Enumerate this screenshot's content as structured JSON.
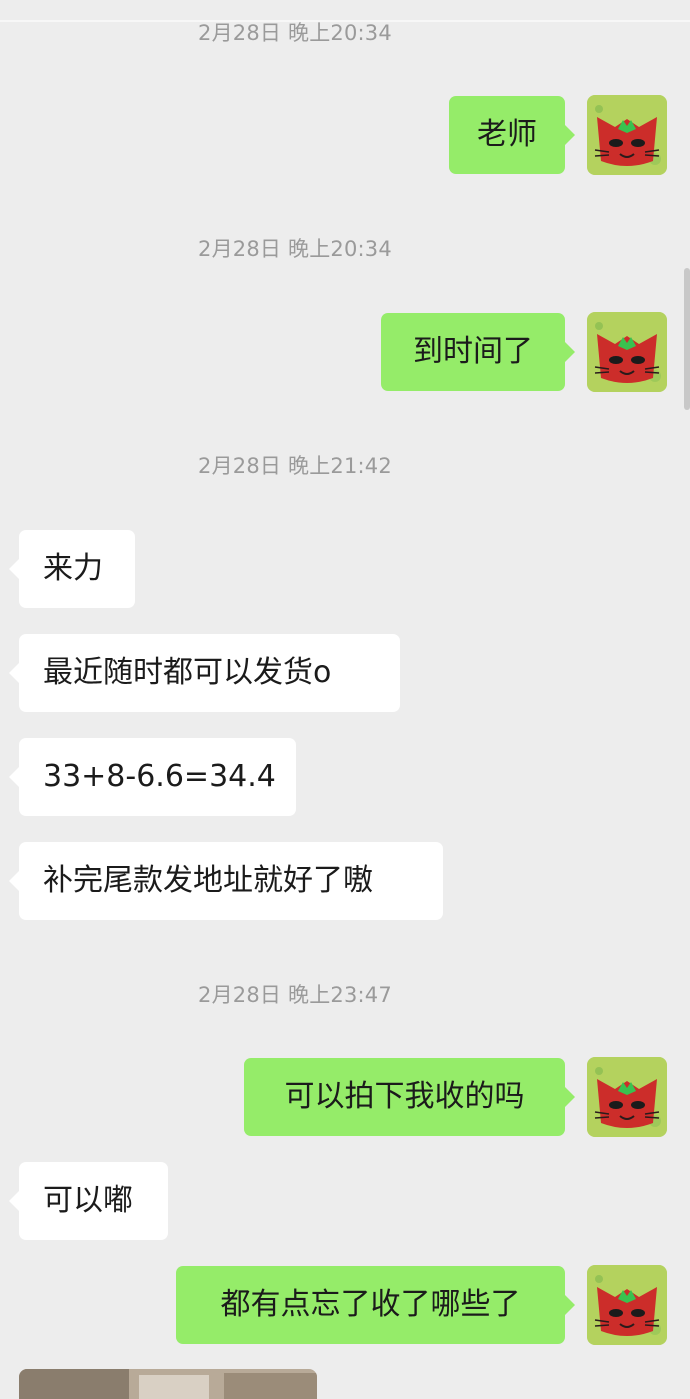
{
  "chat": {
    "timestamps": [
      "2月28日 晚上20:34",
      "2月28日 晚上20:34",
      "2月28日 晚上21:42",
      "2月28日 晚上23:47"
    ],
    "messages": [
      {
        "side": "out",
        "text": "老师"
      },
      {
        "side": "out",
        "text": "到时间了"
      },
      {
        "side": "in",
        "text": "来力"
      },
      {
        "side": "in",
        "text": "最近随时都可以发货o"
      },
      {
        "side": "in",
        "text": "33+8-6.6=34.4"
      },
      {
        "side": "in",
        "text": "补完尾款发地址就好了嗷"
      },
      {
        "side": "out",
        "text": "可以拍下我收的吗"
      },
      {
        "side": "in",
        "text": "可以嘟"
      },
      {
        "side": "out",
        "text": "都有点忘了收了哪些了"
      }
    ]
  },
  "colors": {
    "background": "#ededed",
    "incoming_bubble": "#ffffff",
    "outgoing_bubble": "#95ec69",
    "timestamp_text": "#9a9a9a",
    "message_text": "#1b1b1b"
  },
  "icons": {
    "avatar": "red-cat-face-avatar-icon"
  }
}
